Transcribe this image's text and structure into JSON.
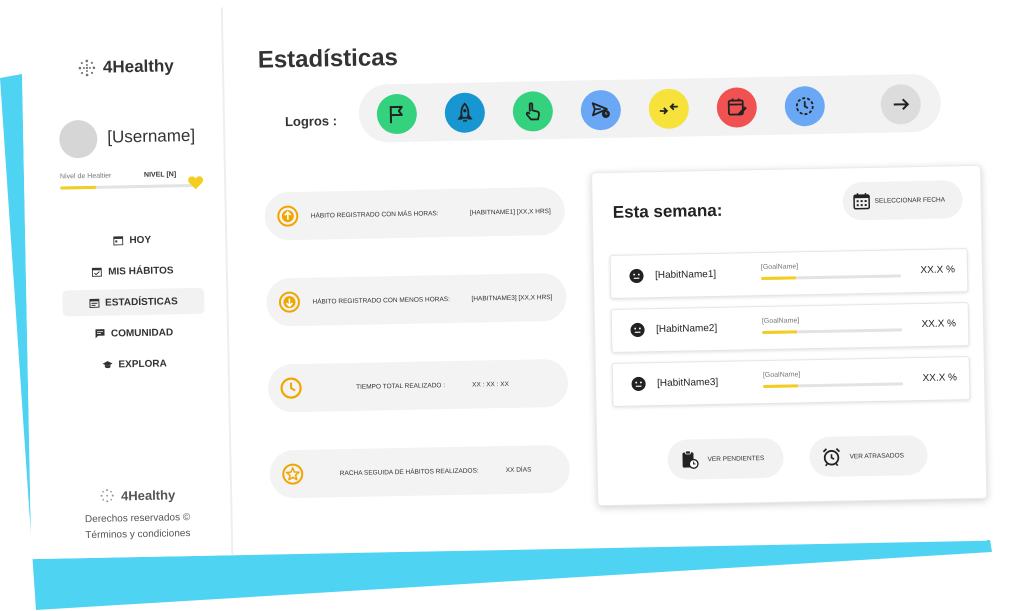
{
  "app": {
    "brand": "4Healthy",
    "colors": {
      "accent_blue": "#4fd3f3",
      "yellow": "#f5cd1f",
      "orange": "#f0a500"
    }
  },
  "sidebar": {
    "username": "[Username]",
    "level_label": "Nivel de Healtier",
    "level_value": "NIVEL [N]",
    "level_progress": 0.27,
    "nav": [
      {
        "label": "HOY",
        "icon": "calendar-day-icon"
      },
      {
        "label": "MIS HÁBITOS",
        "icon": "calendar-check-icon"
      },
      {
        "label": "ESTADÍSTICAS",
        "icon": "calendar-stats-icon",
        "active": true
      },
      {
        "label": "COMUNIDAD",
        "icon": "chat-icon"
      },
      {
        "label": "EXPLORA",
        "icon": "graduation-cap-icon"
      }
    ],
    "footer": {
      "brand": "4Healthy",
      "rights": "Derechos reservados ©",
      "terms": "Términos y condiciones"
    }
  },
  "main": {
    "title": "Estadísticas",
    "logros_label": "Logros :",
    "badges": [
      {
        "icon": "flag-icon",
        "color": "#34d17f"
      },
      {
        "icon": "rocket-icon",
        "color": "#1796d2"
      },
      {
        "icon": "hand-pointer-icon",
        "color": "#34d17f"
      },
      {
        "icon": "send-clock-icon",
        "color": "#6aa8f5"
      },
      {
        "icon": "arrows-in-icon",
        "color": "#f7e23c"
      },
      {
        "icon": "calendar-edit-icon",
        "color": "#f05252"
      },
      {
        "icon": "clock-dashed-icon",
        "color": "#6aa8f5"
      },
      {
        "icon": "arrow-right-icon",
        "color": "#dcdcdc"
      }
    ],
    "stats": [
      {
        "icon": "arrow-up-circle-icon",
        "label": "HÁBITO REGISTRADO CON MÁS HORAS:",
        "value": "[HABITNAME1] [XX,X HRS]"
      },
      {
        "icon": "arrow-down-circle-icon",
        "label": "HÁBITO REGISTRADO CON MENOS HORAS:",
        "value": "[HABITNAME3] [XX,X HRS]"
      },
      {
        "icon": "clock-icon",
        "label": "TIEMPO TOTAL REALIZADO :",
        "value": "XX : XX : XX"
      },
      {
        "icon": "star-circle-icon",
        "label": "RACHA SEGUIDA DE HÁBITOS REALIZADOS:",
        "value": "XX DÍAS"
      }
    ],
    "week": {
      "title": "Esta semana:",
      "select_date": "SELECCIONAR FECHA",
      "habits": [
        {
          "name": "[HabitName1]",
          "goal": "[GoalName]",
          "progress": 0.25,
          "percent": "XX.X %"
        },
        {
          "name": "[HabitName2]",
          "goal": "[GoalName]",
          "progress": 0.25,
          "percent": "XX.X %"
        },
        {
          "name": "[HabitName3]",
          "goal": "[GoalName]",
          "progress": 0.25,
          "percent": "XX.X %"
        }
      ],
      "pending_label": "VER PENDIENTES",
      "late_label": "VER ATRASADOS"
    }
  }
}
